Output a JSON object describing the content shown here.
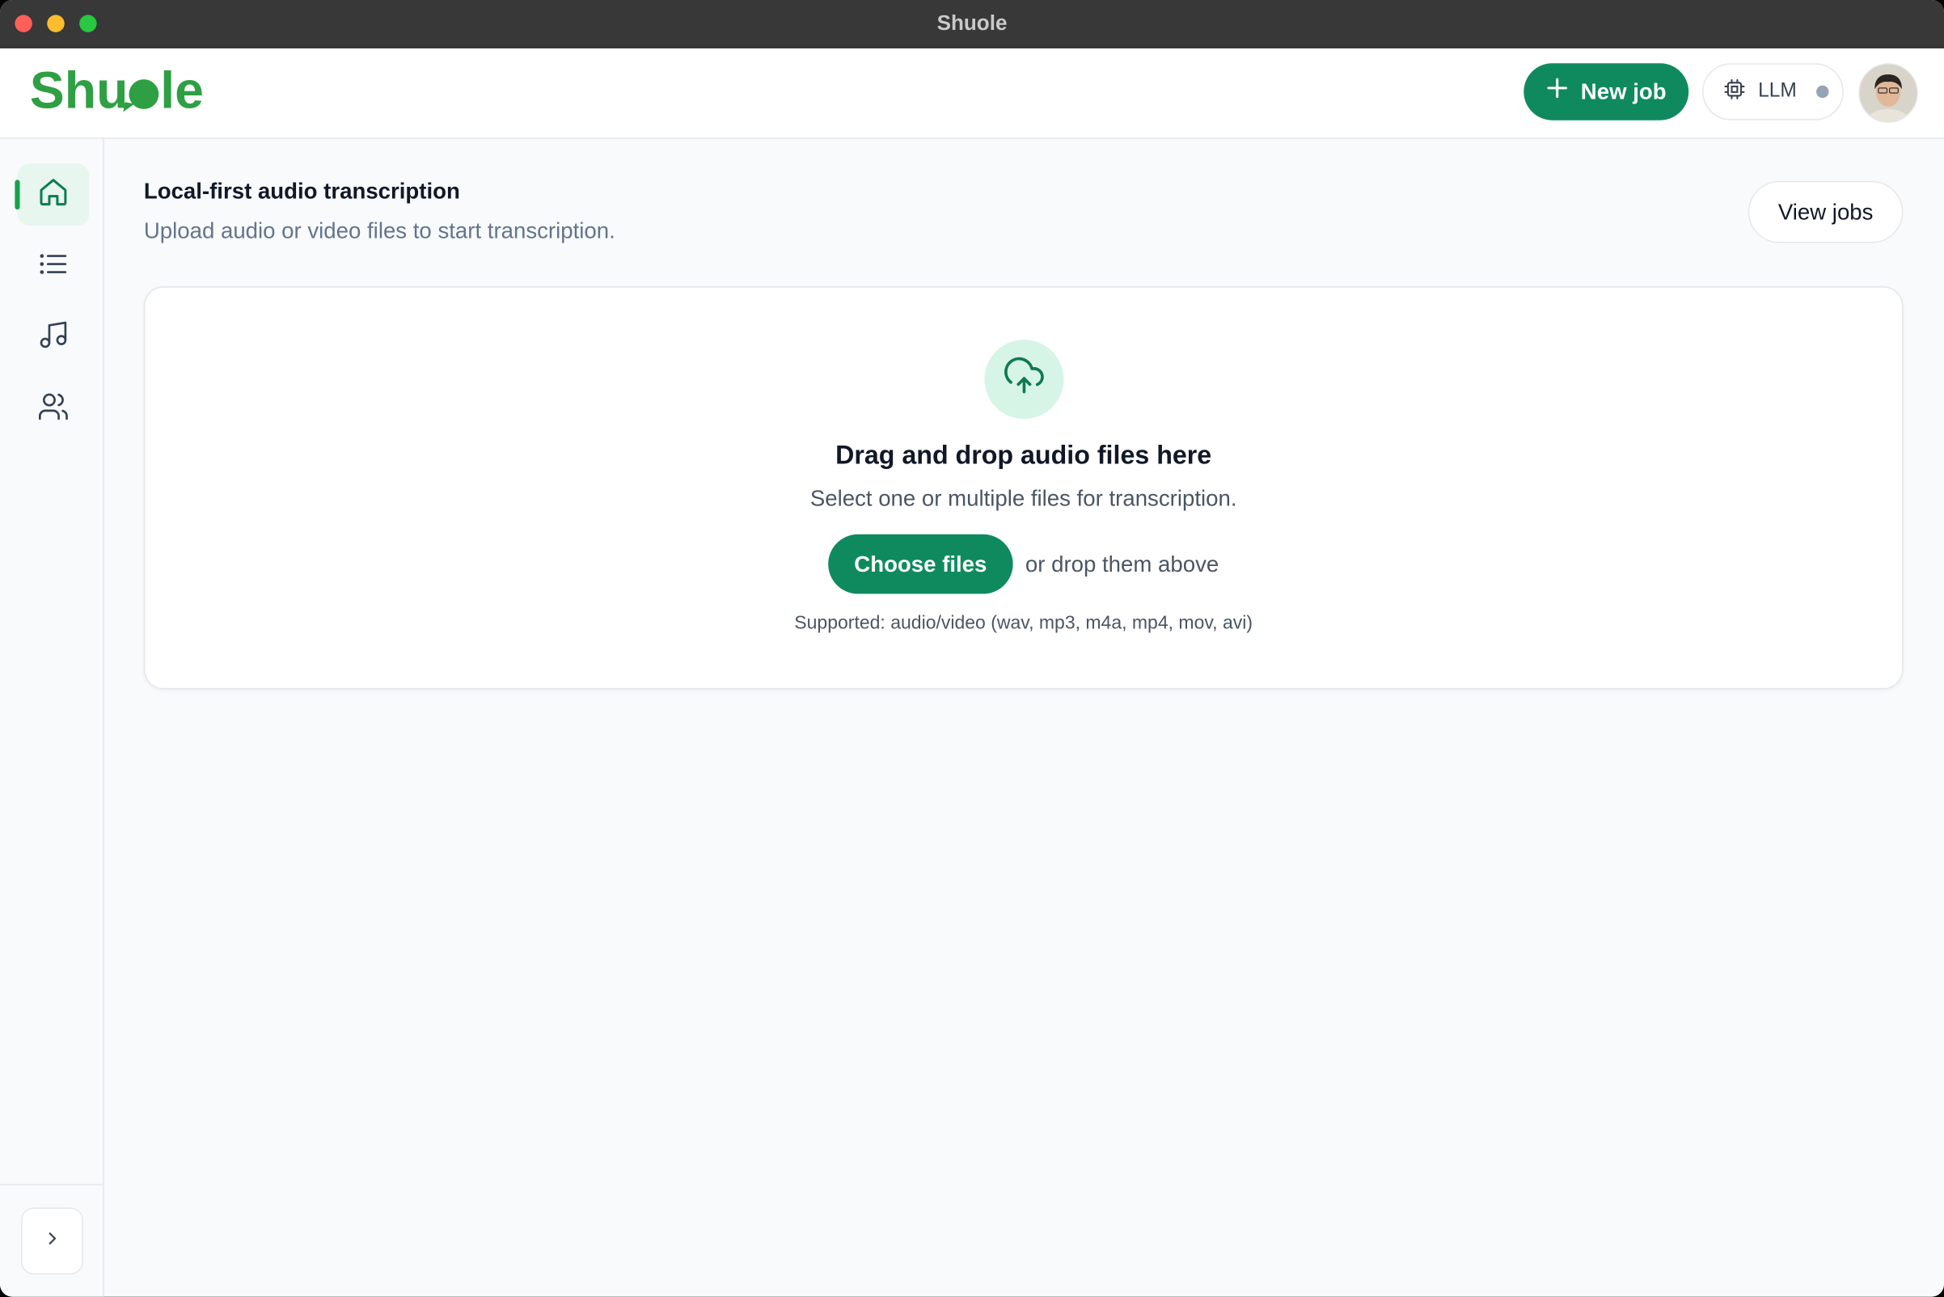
{
  "window": {
    "title": "Shuole"
  },
  "header": {
    "logo_text": "Shuole",
    "new_job_label": "New job",
    "llm_label": "LLM",
    "llm_status_color": "#94a3b8",
    "accent_color": "#0f8a5f"
  },
  "sidebar": {
    "items": [
      {
        "name": "home",
        "icon": "home-icon",
        "active": true
      },
      {
        "name": "list",
        "icon": "list-icon",
        "active": false
      },
      {
        "name": "music",
        "icon": "music-note-icon",
        "active": false
      },
      {
        "name": "people",
        "icon": "users-icon",
        "active": false
      }
    ],
    "expand_icon": "chevron-right-icon"
  },
  "main": {
    "title": "Local-first audio transcription",
    "subtitle": "Upload audio or video files to start transcription.",
    "view_jobs_label": "View jobs",
    "dropzone": {
      "icon": "cloud-upload-icon",
      "title": "Drag and drop audio files here",
      "subtitle": "Select one or multiple files for transcription.",
      "choose_label": "Choose files",
      "or_text": "or drop them above",
      "supported_text": "Supported: audio/video (wav, mp3, m4a, mp4, mov, avi)"
    }
  }
}
